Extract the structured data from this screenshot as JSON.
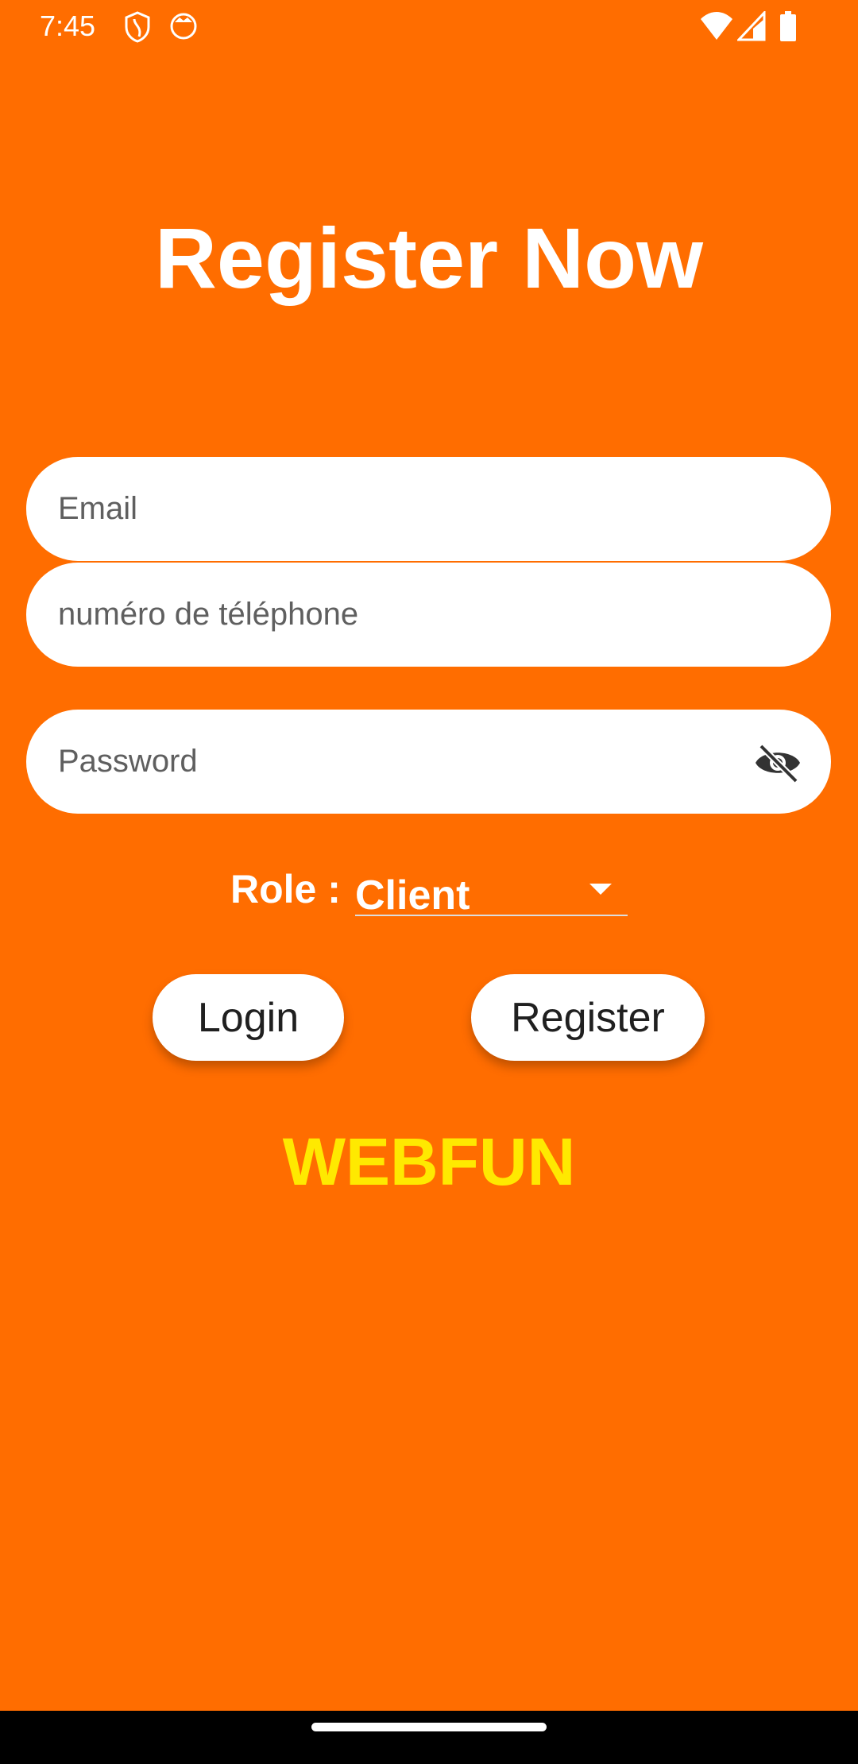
{
  "status_bar": {
    "time": "7:45",
    "icons": [
      "shield-icon",
      "cat-icon",
      "wifi-icon",
      "signal-icon",
      "battery-icon"
    ]
  },
  "title": "Register Now",
  "form": {
    "email_placeholder": "Email",
    "phone_placeholder": "numéro de téléphone",
    "password_placeholder": "Password",
    "role_label": "Role :",
    "role_value": "Client"
  },
  "buttons": {
    "login": "Login",
    "register": "Register"
  },
  "brand": "WEBFUN",
  "colors": {
    "background": "#FF6D00",
    "brand": "#FFE900"
  }
}
